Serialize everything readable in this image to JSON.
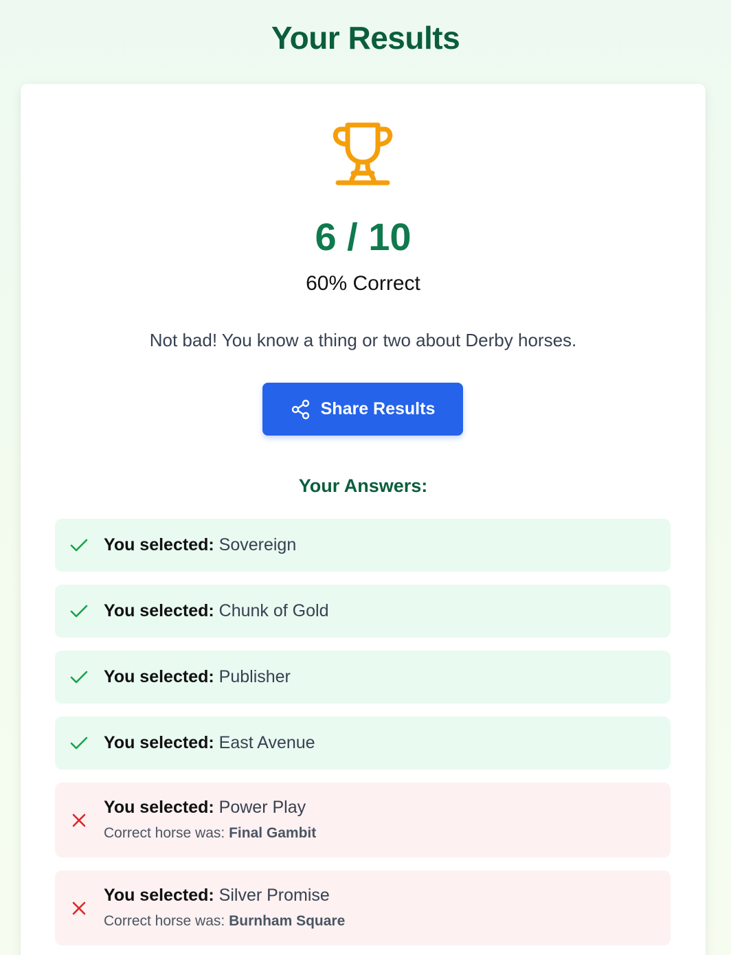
{
  "page": {
    "title": "Your Results"
  },
  "result": {
    "score": "6 / 10",
    "percent": "60% Correct",
    "message": "Not bad! You know a thing or two about Derby horses.",
    "share_label": "Share Results",
    "trophy_color": "#f59e0b"
  },
  "answers_heading": "Your Answers:",
  "labels": {
    "selected": "You selected:",
    "correct_was": "Correct horse was:"
  },
  "answers": [
    {
      "status": "correct",
      "selected": "Sovereign"
    },
    {
      "status": "correct",
      "selected": "Chunk of Gold"
    },
    {
      "status": "correct",
      "selected": "Publisher"
    },
    {
      "status": "correct",
      "selected": "East Avenue"
    },
    {
      "status": "wrong",
      "selected": "Power Play",
      "correct": "Final Gambit"
    },
    {
      "status": "wrong",
      "selected": "Silver Promise",
      "correct": "Burnham Square"
    }
  ],
  "colors": {
    "heading_green": "#0b5e3c",
    "score_green": "#0f7a4d",
    "correct_bg": "#e9faf1",
    "wrong_bg": "#fdf1f1",
    "check": "#16a34a",
    "cross": "#dc2626",
    "button": "#2563eb"
  }
}
